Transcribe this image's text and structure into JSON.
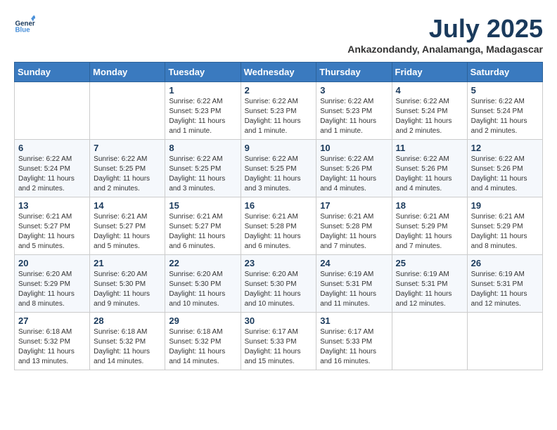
{
  "header": {
    "logo_general": "General",
    "logo_blue": "Blue",
    "month_year": "July 2025",
    "location": "Ankazondandy, Analamanga, Madagascar"
  },
  "weekdays": [
    "Sunday",
    "Monday",
    "Tuesday",
    "Wednesday",
    "Thursday",
    "Friday",
    "Saturday"
  ],
  "weeks": [
    [
      {
        "day": "",
        "info": ""
      },
      {
        "day": "",
        "info": ""
      },
      {
        "day": "1",
        "info": "Sunrise: 6:22 AM\nSunset: 5:23 PM\nDaylight: 11 hours\nand 1 minute."
      },
      {
        "day": "2",
        "info": "Sunrise: 6:22 AM\nSunset: 5:23 PM\nDaylight: 11 hours\nand 1 minute."
      },
      {
        "day": "3",
        "info": "Sunrise: 6:22 AM\nSunset: 5:23 PM\nDaylight: 11 hours\nand 1 minute."
      },
      {
        "day": "4",
        "info": "Sunrise: 6:22 AM\nSunset: 5:24 PM\nDaylight: 11 hours\nand 2 minutes."
      },
      {
        "day": "5",
        "info": "Sunrise: 6:22 AM\nSunset: 5:24 PM\nDaylight: 11 hours\nand 2 minutes."
      }
    ],
    [
      {
        "day": "6",
        "info": "Sunrise: 6:22 AM\nSunset: 5:24 PM\nDaylight: 11 hours\nand 2 minutes."
      },
      {
        "day": "7",
        "info": "Sunrise: 6:22 AM\nSunset: 5:25 PM\nDaylight: 11 hours\nand 2 minutes."
      },
      {
        "day": "8",
        "info": "Sunrise: 6:22 AM\nSunset: 5:25 PM\nDaylight: 11 hours\nand 3 minutes."
      },
      {
        "day": "9",
        "info": "Sunrise: 6:22 AM\nSunset: 5:25 PM\nDaylight: 11 hours\nand 3 minutes."
      },
      {
        "day": "10",
        "info": "Sunrise: 6:22 AM\nSunset: 5:26 PM\nDaylight: 11 hours\nand 4 minutes."
      },
      {
        "day": "11",
        "info": "Sunrise: 6:22 AM\nSunset: 5:26 PM\nDaylight: 11 hours\nand 4 minutes."
      },
      {
        "day": "12",
        "info": "Sunrise: 6:22 AM\nSunset: 5:26 PM\nDaylight: 11 hours\nand 4 minutes."
      }
    ],
    [
      {
        "day": "13",
        "info": "Sunrise: 6:21 AM\nSunset: 5:27 PM\nDaylight: 11 hours\nand 5 minutes."
      },
      {
        "day": "14",
        "info": "Sunrise: 6:21 AM\nSunset: 5:27 PM\nDaylight: 11 hours\nand 5 minutes."
      },
      {
        "day": "15",
        "info": "Sunrise: 6:21 AM\nSunset: 5:27 PM\nDaylight: 11 hours\nand 6 minutes."
      },
      {
        "day": "16",
        "info": "Sunrise: 6:21 AM\nSunset: 5:28 PM\nDaylight: 11 hours\nand 6 minutes."
      },
      {
        "day": "17",
        "info": "Sunrise: 6:21 AM\nSunset: 5:28 PM\nDaylight: 11 hours\nand 7 minutes."
      },
      {
        "day": "18",
        "info": "Sunrise: 6:21 AM\nSunset: 5:29 PM\nDaylight: 11 hours\nand 7 minutes."
      },
      {
        "day": "19",
        "info": "Sunrise: 6:21 AM\nSunset: 5:29 PM\nDaylight: 11 hours\nand 8 minutes."
      }
    ],
    [
      {
        "day": "20",
        "info": "Sunrise: 6:20 AM\nSunset: 5:29 PM\nDaylight: 11 hours\nand 8 minutes."
      },
      {
        "day": "21",
        "info": "Sunrise: 6:20 AM\nSunset: 5:30 PM\nDaylight: 11 hours\nand 9 minutes."
      },
      {
        "day": "22",
        "info": "Sunrise: 6:20 AM\nSunset: 5:30 PM\nDaylight: 11 hours\nand 10 minutes."
      },
      {
        "day": "23",
        "info": "Sunrise: 6:20 AM\nSunset: 5:30 PM\nDaylight: 11 hours\nand 10 minutes."
      },
      {
        "day": "24",
        "info": "Sunrise: 6:19 AM\nSunset: 5:31 PM\nDaylight: 11 hours\nand 11 minutes."
      },
      {
        "day": "25",
        "info": "Sunrise: 6:19 AM\nSunset: 5:31 PM\nDaylight: 11 hours\nand 12 minutes."
      },
      {
        "day": "26",
        "info": "Sunrise: 6:19 AM\nSunset: 5:31 PM\nDaylight: 11 hours\nand 12 minutes."
      }
    ],
    [
      {
        "day": "27",
        "info": "Sunrise: 6:18 AM\nSunset: 5:32 PM\nDaylight: 11 hours\nand 13 minutes."
      },
      {
        "day": "28",
        "info": "Sunrise: 6:18 AM\nSunset: 5:32 PM\nDaylight: 11 hours\nand 14 minutes."
      },
      {
        "day": "29",
        "info": "Sunrise: 6:18 AM\nSunset: 5:32 PM\nDaylight: 11 hours\nand 14 minutes."
      },
      {
        "day": "30",
        "info": "Sunrise: 6:17 AM\nSunset: 5:33 PM\nDaylight: 11 hours\nand 15 minutes."
      },
      {
        "day": "31",
        "info": "Sunrise: 6:17 AM\nSunset: 5:33 PM\nDaylight: 11 hours\nand 16 minutes."
      },
      {
        "day": "",
        "info": ""
      },
      {
        "day": "",
        "info": ""
      }
    ]
  ]
}
